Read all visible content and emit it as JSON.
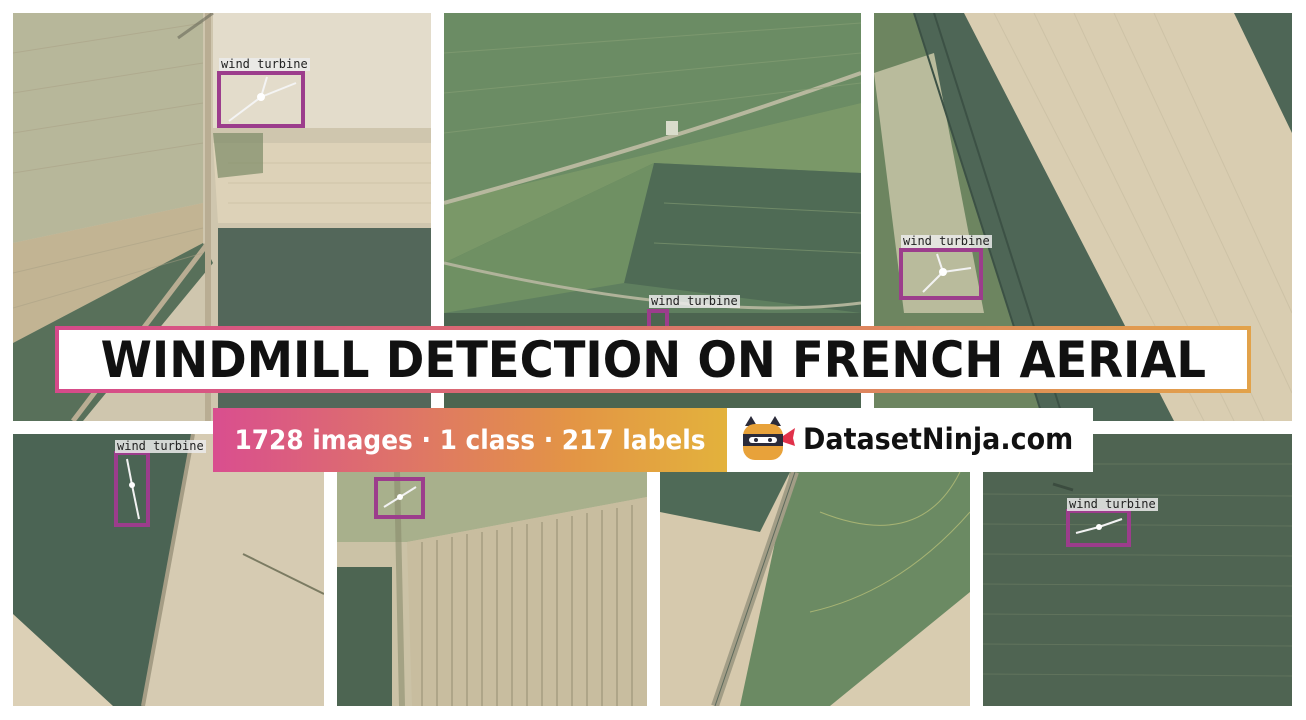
{
  "title": "WINDMILL DETECTION ON FRENCH AERIAL",
  "stats": "1728 images · 1 class · 217 labels",
  "brand": "DatasetNinja.com",
  "detection_label": "wind turbine",
  "icons": {
    "logo": "ninja-cat-logo-icon",
    "object": "wind-turbine-icon"
  },
  "colors": {
    "bbox": "#9c3d8c",
    "gradient_start": "#d94e8f",
    "gradient_end": "#e3b23c",
    "field_green": "#5c7a5c",
    "field_tan": "#d6cdb6"
  }
}
